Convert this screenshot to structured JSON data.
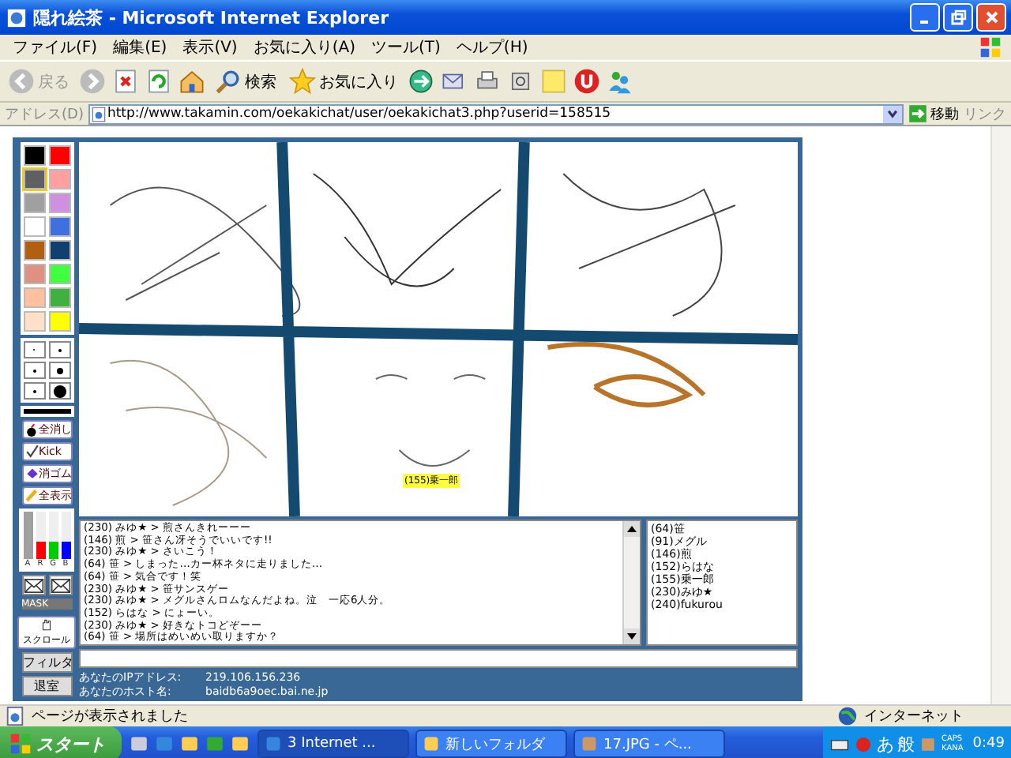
{
  "window": {
    "title": "隠れ絵茶 - Microsoft Internet Explorer"
  },
  "menu": [
    "ファイル(F)",
    "編集(E)",
    "表示(V)",
    "お気に入り(A)",
    "ツール(T)",
    "ヘルプ(H)"
  ],
  "toolbar": {
    "back": "戻る",
    "search": "検索",
    "favorites": "お気に入り"
  },
  "address": {
    "label": "アドレス(D)",
    "url": "http://www.takamin.com/oekakichat/user/oekakichat3.php?userid=158515",
    "go": "移動",
    "links": "リンク"
  },
  "palette": [
    {
      "color": "#000000",
      "selected": false
    },
    {
      "color": "#ff0000",
      "selected": false
    },
    {
      "color": "#606060",
      "selected": true
    },
    {
      "color": "#ffa0a0",
      "selected": false
    },
    {
      "color": "#a0a0a0",
      "selected": false
    },
    {
      "color": "#d090e0",
      "selected": false
    },
    {
      "color": "#ffffff",
      "selected": false
    },
    {
      "color": "#4070e0",
      "selected": false
    },
    {
      "color": "#b06010",
      "selected": false
    },
    {
      "color": "#104070",
      "selected": false
    },
    {
      "color": "#e09080",
      "selected": false
    },
    {
      "color": "#40ff40",
      "selected": false
    },
    {
      "color": "#ffc0a0",
      "selected": false
    },
    {
      "color": "#40b040",
      "selected": false
    },
    {
      "color": "#ffe0c8",
      "selected": false
    },
    {
      "color": "#ffff00",
      "selected": false
    }
  ],
  "tool_buttons": [
    "全消し",
    "Kick",
    "消ゴム",
    "全表示"
  ],
  "sliders": [
    {
      "label": "A",
      "color": "#a0a0a0",
      "level": 1
    },
    {
      "label": "R",
      "color": "#ff0000",
      "level": 0.35
    },
    {
      "label": "G",
      "color": "#00cc00",
      "level": 0.35
    },
    {
      "label": "B",
      "color": "#0000ff",
      "level": 0.35
    }
  ],
  "mask_label": "MASK",
  "scroll_button": "スクロール",
  "canvas": {
    "name_tag": "(155)乗一郎"
  },
  "chat": [
    "(230) みゆ★ > 煎さんきれーーー",
    "(146) 煎 > 笹さん冴そうでいいです!!",
    "(230) みゆ★ > さいこう！",
    "(64) 笹 > しまった…カー杯ネタに走りました…",
    "(64) 笹 > 気合です！笑",
    "(230) みゆ★ > 笹サンスゲー",
    "(230) みゆ★ > メグルさんロムなんだよね。泣　一応6人分。",
    "(152) らはな > にょーい。",
    "(230) みゆ★ > 好きなトコどぞーー",
    "(64) 笹 > 場所はめいめい取りますか？"
  ],
  "users": [
    "(64)笹",
    "(91)メグル",
    "(146)煎",
    "(152)らはな",
    "(155)乗一郎",
    "(230)みゆ★",
    "(240)fukurou"
  ],
  "filter_button": "フィルタ",
  "exit_button": "退室",
  "info": [
    {
      "label": "あなたのIPアドレス:",
      "value": "219.106.156.236"
    },
    {
      "label": "あなたのホスト名:",
      "value": "baidb6a9oec.bai.ne.jp"
    }
  ],
  "status_bar": {
    "text": "ページが表示されました",
    "zone": "インターネット"
  },
  "taskbar": {
    "start": "スタート",
    "tasks": [
      "3 Internet ...",
      "新しいフォルダ",
      "17.JPG - ペ..."
    ],
    "ime": [
      "あ",
      "般"
    ],
    "keys": [
      "CAPS",
      "KANA"
    ],
    "clock": "0:49"
  }
}
